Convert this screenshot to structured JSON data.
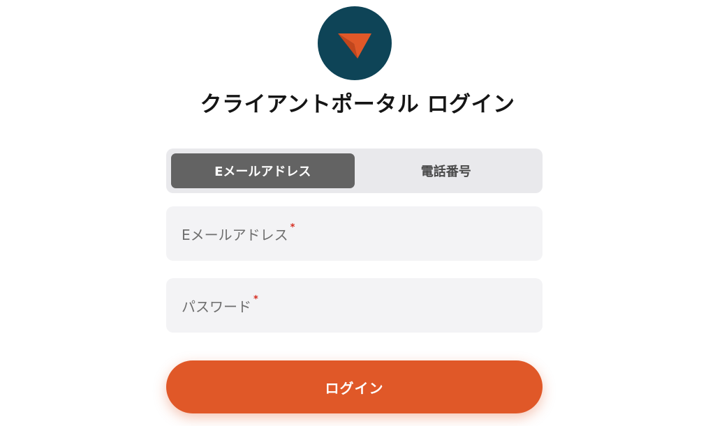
{
  "brand": {
    "logo_icon": "paper-plane-arrow-icon",
    "logo_bg_color": "#0e4457",
    "logo_arrow_color": "#e05828"
  },
  "header": {
    "title": "クライアントポータル ログイン"
  },
  "tabs": [
    {
      "label": "Eメールアドレス",
      "active": true
    },
    {
      "label": "電話番号",
      "active": false
    }
  ],
  "form": {
    "email": {
      "label": "Eメールアドレス",
      "required_mark": "*",
      "value": ""
    },
    "password": {
      "label": "パスワード",
      "required_mark": "*",
      "value": ""
    }
  },
  "actions": {
    "login_label": "ログイン",
    "login_color": "#e05828"
  }
}
